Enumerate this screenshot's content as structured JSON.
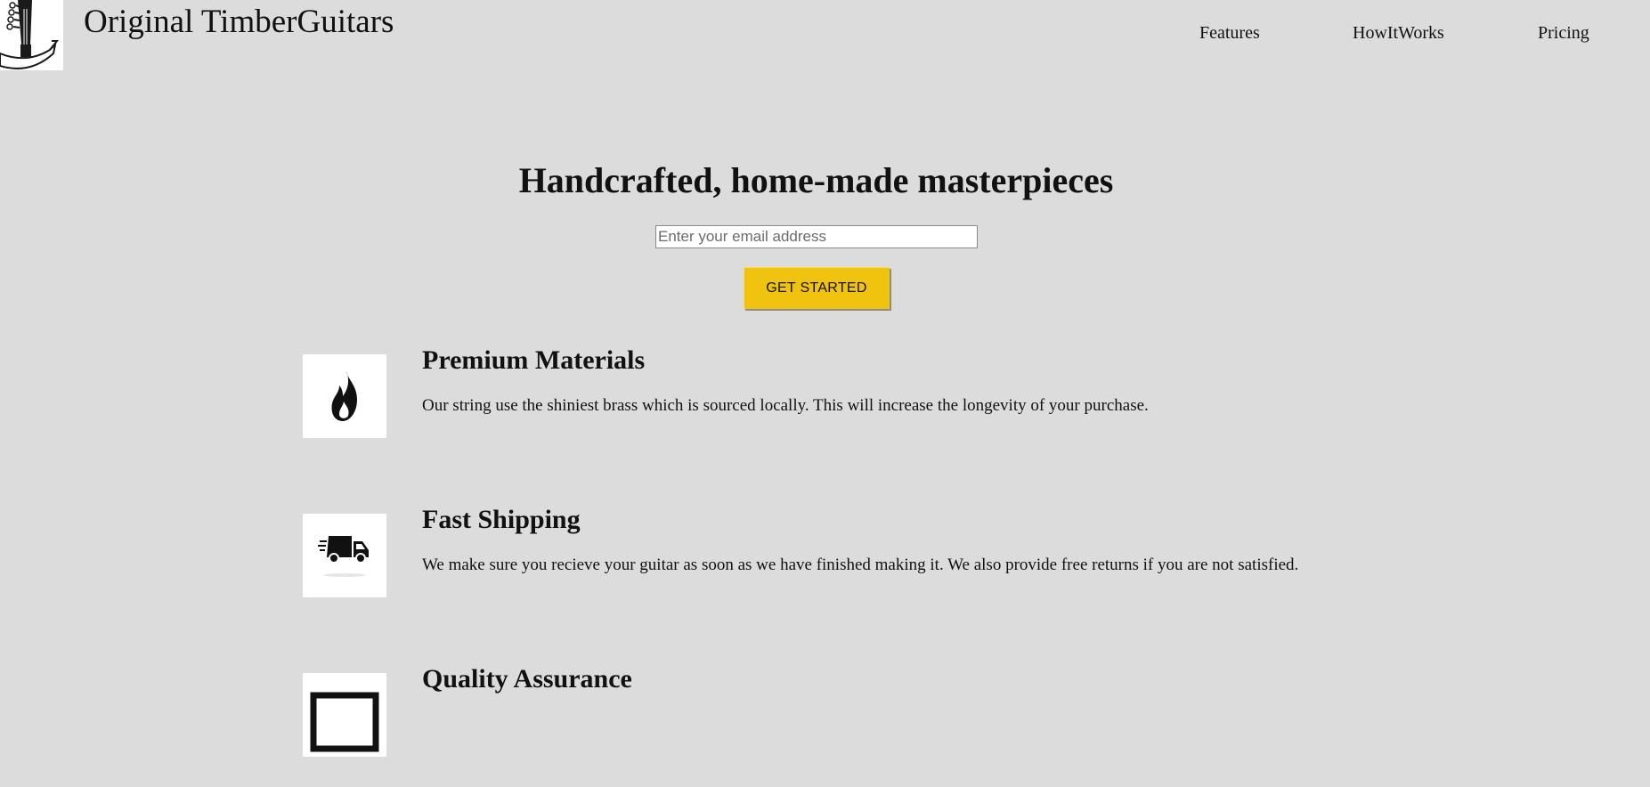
{
  "header": {
    "brand": "Original TimberGuitars",
    "logo_icon": "guitar-headstock-banner-icon",
    "nav": [
      {
        "label": "Features"
      },
      {
        "label": "HowItWorks"
      },
      {
        "label": "Pricing"
      }
    ]
  },
  "hero": {
    "title": "Handcrafted, home-made masterpieces",
    "email_placeholder": "Enter your email address",
    "email_value": "",
    "cta_label": "GET STARTED",
    "cta_color": "#f0c30f"
  },
  "features": [
    {
      "icon": "flame-icon",
      "title": "Premium Materials",
      "description": "Our string use the shiniest brass which is sourced locally. This will increase the longevity of your purchase."
    },
    {
      "icon": "delivery-truck-icon",
      "title": "Fast Shipping",
      "description": "We make sure you recieve your guitar as soon as we have finished making it. We also provide free returns if you are not satisfied."
    },
    {
      "icon": "certificate-icon",
      "title": "Quality Assurance",
      "description": ""
    }
  ],
  "colors": {
    "background": "#dcdcdc",
    "card": "#ffffff",
    "text": "#111111"
  }
}
